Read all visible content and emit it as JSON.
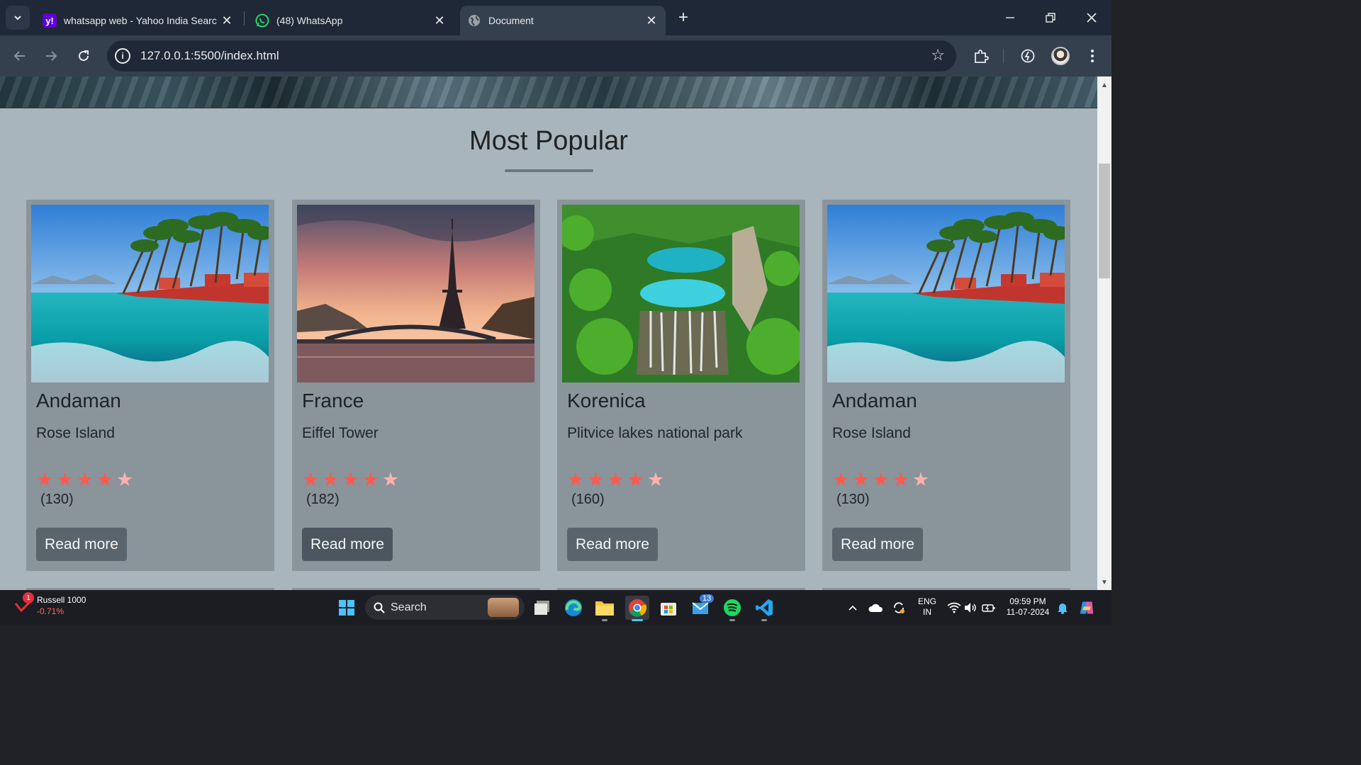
{
  "browser": {
    "tabs": [
      {
        "title": "whatsapp web - Yahoo India Searc",
        "favicon": "yahoo-icon",
        "active": false
      },
      {
        "title": "(48) WhatsApp",
        "favicon": "whatsapp-icon",
        "active": false
      },
      {
        "title": "Document",
        "favicon": "globe-icon",
        "active": true
      }
    ],
    "url": "127.0.0.1:5500/index.html"
  },
  "page": {
    "section_title": "Most Popular",
    "cards": [
      {
        "name": "Andaman",
        "subtitle": "Rose Island",
        "rating": 4.5,
        "reviews": "(130)",
        "button": "Read more",
        "image": "tropical-island-image"
      },
      {
        "name": "France",
        "subtitle": "Eiffel Tower",
        "rating": 4.5,
        "reviews": "(182)",
        "button": "Read more",
        "image": "eiffel-tower-image"
      },
      {
        "name": "Korenica",
        "subtitle": "Plitvice lakes national park",
        "rating": 4.5,
        "reviews": "(160)",
        "button": "Read more",
        "image": "waterfall-lakes-image"
      },
      {
        "name": "Andaman",
        "subtitle": "Rose Island",
        "rating": 4.5,
        "reviews": "(130)",
        "button": "Read more",
        "image": "tropical-island-image"
      }
    ],
    "scroll_fraction": 0.2
  },
  "taskbar": {
    "stock_name": "Russell 1000",
    "stock_change": "-0.71%",
    "stock_badge": "1",
    "search_label": "Search",
    "mail_badge": "13",
    "lang_top": "ENG",
    "lang_bottom": "IN",
    "time": "09:59 PM",
    "date": "11-07-2024",
    "colors": {
      "accent": "#4cc2ff",
      "taskbar_bg": "#1c1d22"
    }
  }
}
